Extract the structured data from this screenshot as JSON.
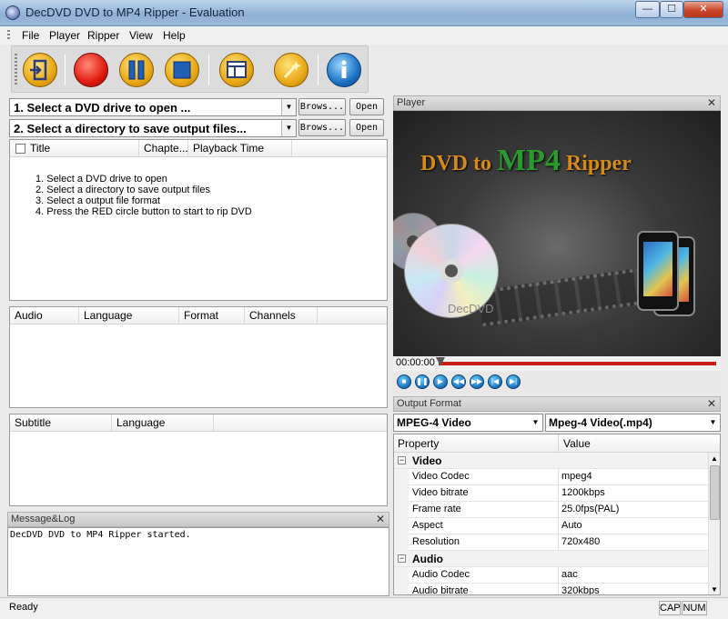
{
  "window": {
    "title": "DecDVD DVD to MP4 Ripper - Evaluation",
    "min_label": "—",
    "max_label": "☐",
    "close_label": "✕"
  },
  "menu": [
    "File",
    "Player",
    "Ripper",
    "View",
    "Help"
  ],
  "source": {
    "dvd_label": "1. Select a DVD drive to open ...",
    "dir_label": "2. Select a directory to save output files...",
    "browse_label": "Brows...",
    "open_label": "Open"
  },
  "titles": {
    "columns": [
      "Title",
      "Chapte...",
      "Playback Time"
    ],
    "instructions": [
      "1. Select a DVD drive to open",
      "2. Select a directory to save output files",
      "3. Select a output file format",
      "4. Press the RED circle button to start to rip DVD"
    ]
  },
  "audio": {
    "columns": [
      "Audio",
      "Language",
      "Format",
      "Channels"
    ]
  },
  "subtitle": {
    "columns": [
      "Subtitle",
      "Language"
    ]
  },
  "log": {
    "title": "Message&Log",
    "lines": [
      "DecDVD DVD to MP4 Ripper started."
    ]
  },
  "player": {
    "title": "Player",
    "headline_a": "DVD to ",
    "headline_b": "MP4",
    "headline_c": " Ripper",
    "watermark": "DecDVD",
    "time": "00:00:00",
    "accent": "#c81e12"
  },
  "output_format": {
    "title": "Output Format",
    "category": "MPEG-4 Video",
    "format": "Mpeg-4 Video(.mp4)",
    "headers": {
      "property": "Property",
      "value": "Value"
    },
    "groups": [
      {
        "name": "Video",
        "rows": [
          {
            "k": "Video Codec",
            "v": "mpeg4"
          },
          {
            "k": "Video bitrate",
            "v": "1200kbps"
          },
          {
            "k": "Frame rate",
            "v": "25.0fps(PAL)"
          },
          {
            "k": "Aspect",
            "v": "Auto"
          },
          {
            "k": "Resolution",
            "v": "720x480"
          }
        ]
      },
      {
        "name": "Audio",
        "rows": [
          {
            "k": "Audio Codec",
            "v": "aac"
          },
          {
            "k": "Audio bitrate",
            "v": "320kbps"
          }
        ]
      }
    ]
  },
  "status": {
    "text": "Ready",
    "cap": "CAP",
    "num": "NUM"
  }
}
